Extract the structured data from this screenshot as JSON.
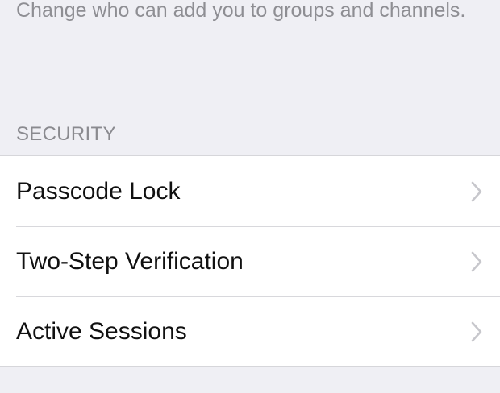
{
  "privacy": {
    "groups_description": "Change who can add you to groups and channels."
  },
  "security": {
    "header": "SECURITY",
    "items": [
      {
        "label": "Passcode Lock",
        "icon": "chevron-right-icon"
      },
      {
        "label": "Two-Step Verification",
        "icon": "chevron-right-icon"
      },
      {
        "label": "Active Sessions",
        "icon": "chevron-right-icon"
      }
    ]
  },
  "colors": {
    "background": "#efeff4",
    "cell": "#ffffff",
    "secondary_text": "#8e8e93",
    "chevron": "#c7c7cc"
  }
}
